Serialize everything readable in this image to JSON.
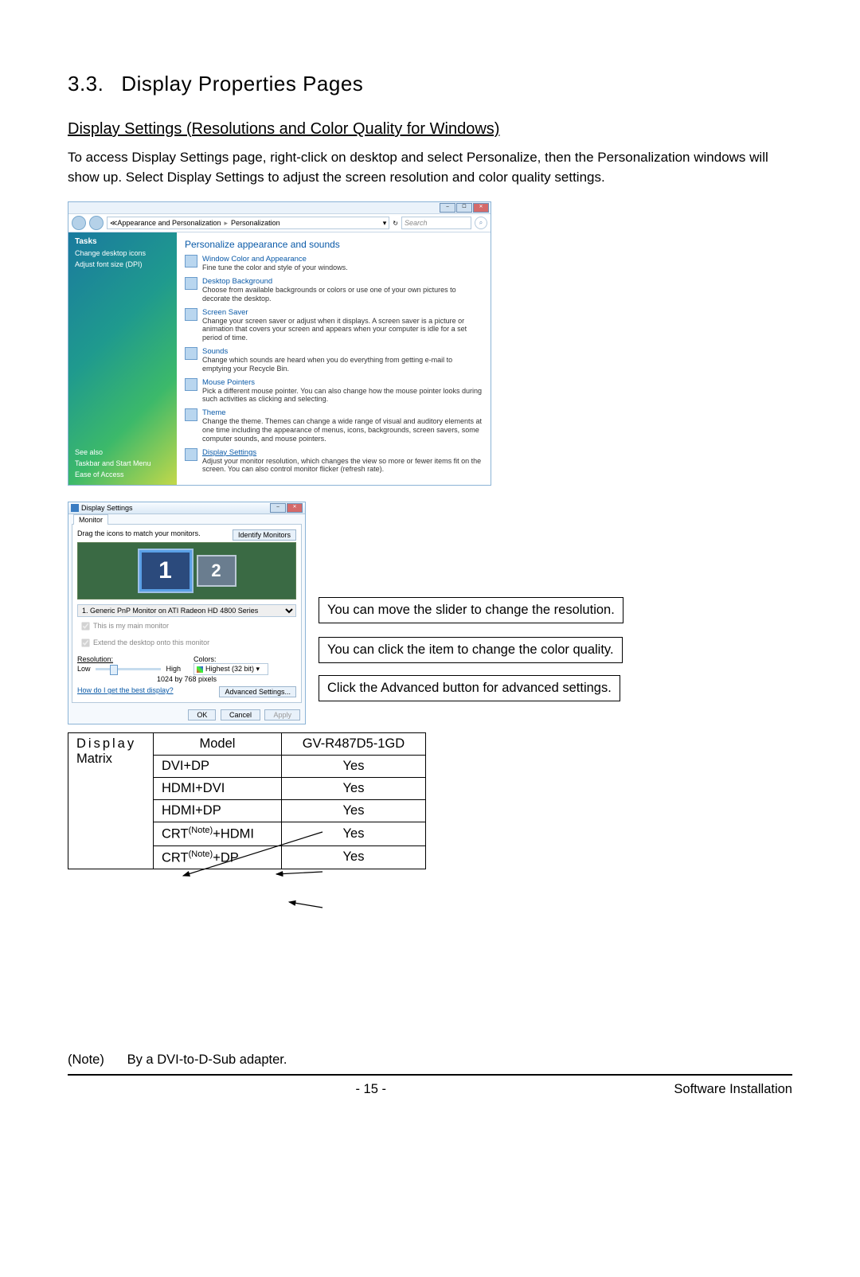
{
  "heading": {
    "number": "3.3.",
    "title": "Display Properties Pages"
  },
  "sub": "Display Settings (Resolutions and Color Quality for Windows)",
  "para1a": "To access ",
  "para1b": "Display Settings",
  "para1c": " page, right-click on desktop and select ",
  "para1d": "Personalize,",
  "para1e": " then the Personalization windows will show up. Select ",
  "para1f": "Display Settings",
  "para1g": " to adjust the screen resolution and color quality settings.",
  "pz": {
    "breadcrumb": {
      "a": "Appearance and Personalization",
      "b": "Personalization"
    },
    "search_ph": "Search",
    "sidebar": {
      "tasks": "Tasks",
      "change_icons": "Change desktop icons",
      "adjust_font": "Adjust font size (DPI)",
      "see_also": "See also",
      "taskbar": "Taskbar and Start Menu",
      "ease": "Ease of Access"
    },
    "heading": "Personalize appearance and sounds",
    "items": [
      {
        "t": "Window Color and Appearance",
        "d": "Fine tune the color and style of your windows."
      },
      {
        "t": "Desktop Background",
        "d": "Choose from available backgrounds or colors or use one of your own pictures to decorate the desktop."
      },
      {
        "t": "Screen Saver",
        "d": "Change your screen saver or adjust when it displays. A screen saver is a picture or animation that covers your screen and appears when your computer is idle for a set period of time."
      },
      {
        "t": "Sounds",
        "d": "Change which sounds are heard when you do everything from getting e-mail to emptying your Recycle Bin."
      },
      {
        "t": "Mouse Pointers",
        "d": "Pick a different mouse pointer. You can also change how the mouse pointer looks during such activities as clicking and selecting."
      },
      {
        "t": "Theme",
        "d": "Change the theme. Themes can change a wide range of visual and auditory elements at one time including the appearance of menus, icons, backgrounds, screen savers, some computer sounds, and mouse pointers."
      },
      {
        "t": "Display Settings",
        "d": "Adjust your monitor resolution, which changes the view so more or fewer items fit on the screen. You can also control monitor flicker (refresh rate)."
      }
    ]
  },
  "ds": {
    "title": "Display Settings",
    "tab": "Monitor",
    "drag": "Drag the icons to match your monitors.",
    "identify": "Identify Monitors",
    "mon1": "1",
    "mon2": "2",
    "device": "1. Generic PnP Monitor on ATI Radeon HD 4800 Series",
    "cb_main": "This is my main monitor",
    "cb_extend": "Extend the desktop onto this monitor",
    "res_label": "Resolution:",
    "low": "Low",
    "high": "High",
    "res_text": "1024 by 768 pixels",
    "col_label": "Colors:",
    "col_val": "Highest (32 bit)",
    "help": "How do I get the best display?",
    "adv": "Advanced Settings...",
    "ok": "OK",
    "cancel": "Cancel",
    "apply": "Apply"
  },
  "callouts": {
    "c1": "You can move the slider to change the resolution.",
    "c2": "You can click the item to change the color quality.",
    "c3a": "Click the ",
    "c3b": "Advanced",
    "c3c": " button for advanced settings."
  },
  "chart_data": {
    "type": "table",
    "title": "Display Matrix",
    "columns": [
      "Model",
      "GV-R487D5-1GD"
    ],
    "rows": [
      {
        "label": "DVI+DP",
        "v": "Yes"
      },
      {
        "label": "HDMI+DVI",
        "v": "Yes"
      },
      {
        "label": "HDMI+DP",
        "v": "Yes"
      },
      {
        "label": "CRT(Note)+HDMI",
        "v": "Yes"
      },
      {
        "label": "CRT(Note)+DP",
        "v": "Yes"
      }
    ]
  },
  "matrix_header": {
    "left": "Display Matrix",
    "left1": "Display",
    "left2": "Matrix",
    "model": "Model",
    "gv": "GV-R487D5-1GD"
  },
  "matrix_rows": [
    {
      "a": "DVI+DP",
      "b": "Yes"
    },
    {
      "a": "HDMI+DVI",
      "b": "Yes"
    },
    {
      "a": "HDMI+DP",
      "b": "Yes"
    },
    {
      "a_pre": "CRT",
      "a_sup": "(Note)",
      "a_post": "+HDMI",
      "b": "Yes"
    },
    {
      "a_pre": "CRT",
      "a_sup": "(Note)",
      "a_post": "+DP",
      "b": "Yes"
    }
  ],
  "note_label": "(Note)",
  "note_text": "By a DVI-to-D-Sub adapter.",
  "page_no": "- 15 -",
  "footer_right": "Software Installation"
}
